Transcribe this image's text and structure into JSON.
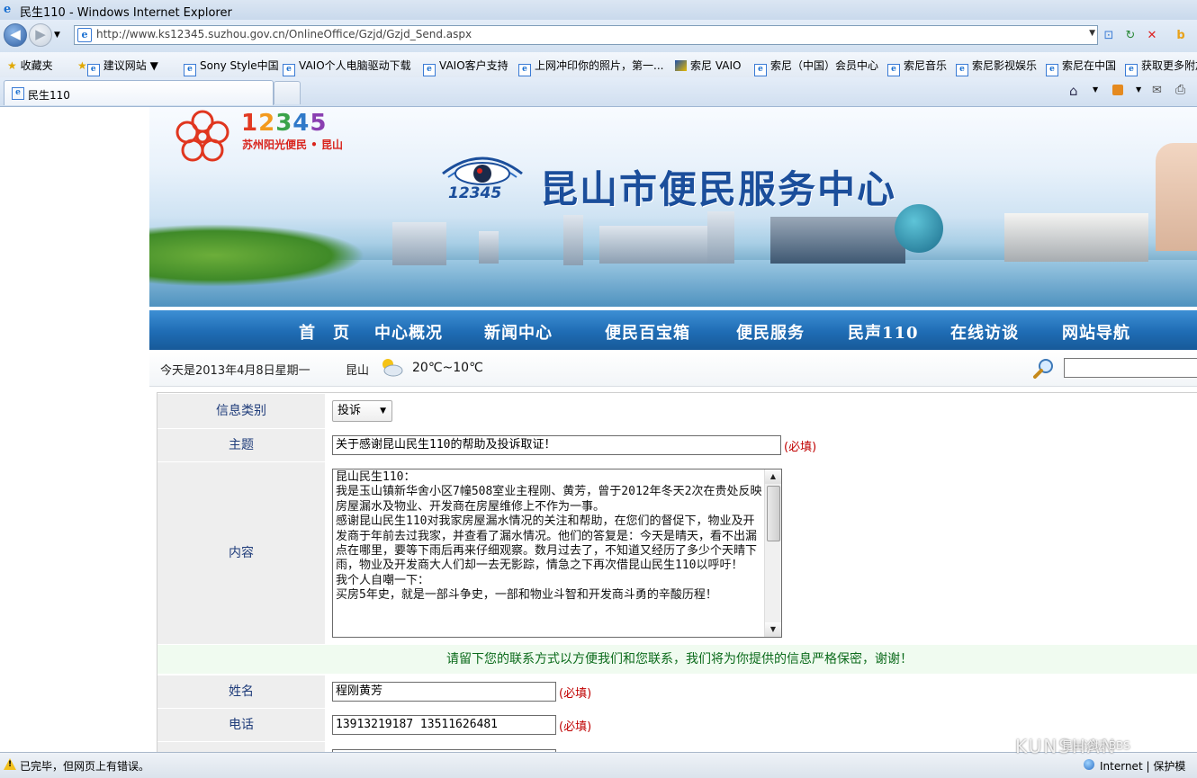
{
  "window": {
    "title": "民生110 - Windows Internet Explorer"
  },
  "address_bar": {
    "url": "http://www.ks12345.suzhou.gov.cn/OnlineOffice/Gzjd/Gzjd_Send.aspx"
  },
  "favorites_bar": {
    "items": [
      "收藏夹",
      "建议网站 ▼",
      "Sony Style中国",
      "VAIO个人电脑驱动下载",
      "VAIO客户支持",
      "上网冲印你的照片，第一...",
      "索尼 VAIO",
      "索尼（中国）会员中心",
      "索尼音乐",
      "索尼影视娱乐",
      "索尼在中国",
      "获取更多附加"
    ]
  },
  "tabs": [
    {
      "label": "民生110"
    }
  ],
  "site": {
    "logo_number": [
      "1",
      "2",
      "3",
      "4",
      "5"
    ],
    "logo_sub": "苏州阳光便民 • 昆山",
    "banner_title": "昆山市便民服务中心",
    "eye_logo_number": "12345",
    "nav": [
      "首　页",
      "中心概况",
      "新闻中心",
      "便民百宝箱",
      "便民服务",
      "民声110",
      "在线访谈",
      "网站导航"
    ],
    "date_text": "今天是2013年4月8日星期一",
    "city": "昆山",
    "temperature": "20℃~10℃"
  },
  "form": {
    "category": {
      "label": "信息类别",
      "value": "投诉"
    },
    "subject": {
      "label": "主题",
      "value": "关于感谢昆山民生110的帮助及投诉取证！",
      "required": "(必填)"
    },
    "content": {
      "label": "内容",
      "value": "昆山民生110：\n我是玉山镇新华舍小区7幢508室业主程刚、黄芳，曾于2012年冬天2次在贵处反映房屋漏水及物业、开发商在房屋维修上不作为一事。\n感谢昆山民生110对我家房屋漏水情况的关注和帮助，在您们的督促下，物业及开发商于年前去过我家，并查看了漏水情况。他们的答复是：今天是晴天，看不出漏点在哪里，要等下雨后再来仔细观察。数月过去了，不知道又经历了多少个天晴下雨，物业及开发商大人们却一去无影踪，情急之下再次借昆山民生110以呼吁！\n我个人自嘲一下：\n买房5年史，就是一部斗争史，一部和物业斗智和开发商斗勇的辛酸历程！"
    },
    "notice": "请留下您的联系方式以方便我们和您联系，我们将为你提供的信息严格保密，谢谢！",
    "name": {
      "label": "姓名",
      "value": "程刚黄芳",
      "required": "(必填)"
    },
    "phone": {
      "label": "电话",
      "value": "13913219187 13511626481",
      "required": "(必填)"
    }
  },
  "status_bar": {
    "message": "已完毕，但网页上有错误。",
    "zone": "Internet | 保护模"
  },
  "watermark": {
    "main": "KUNSHAN",
    "small": "昆山论坛 BBS"
  }
}
